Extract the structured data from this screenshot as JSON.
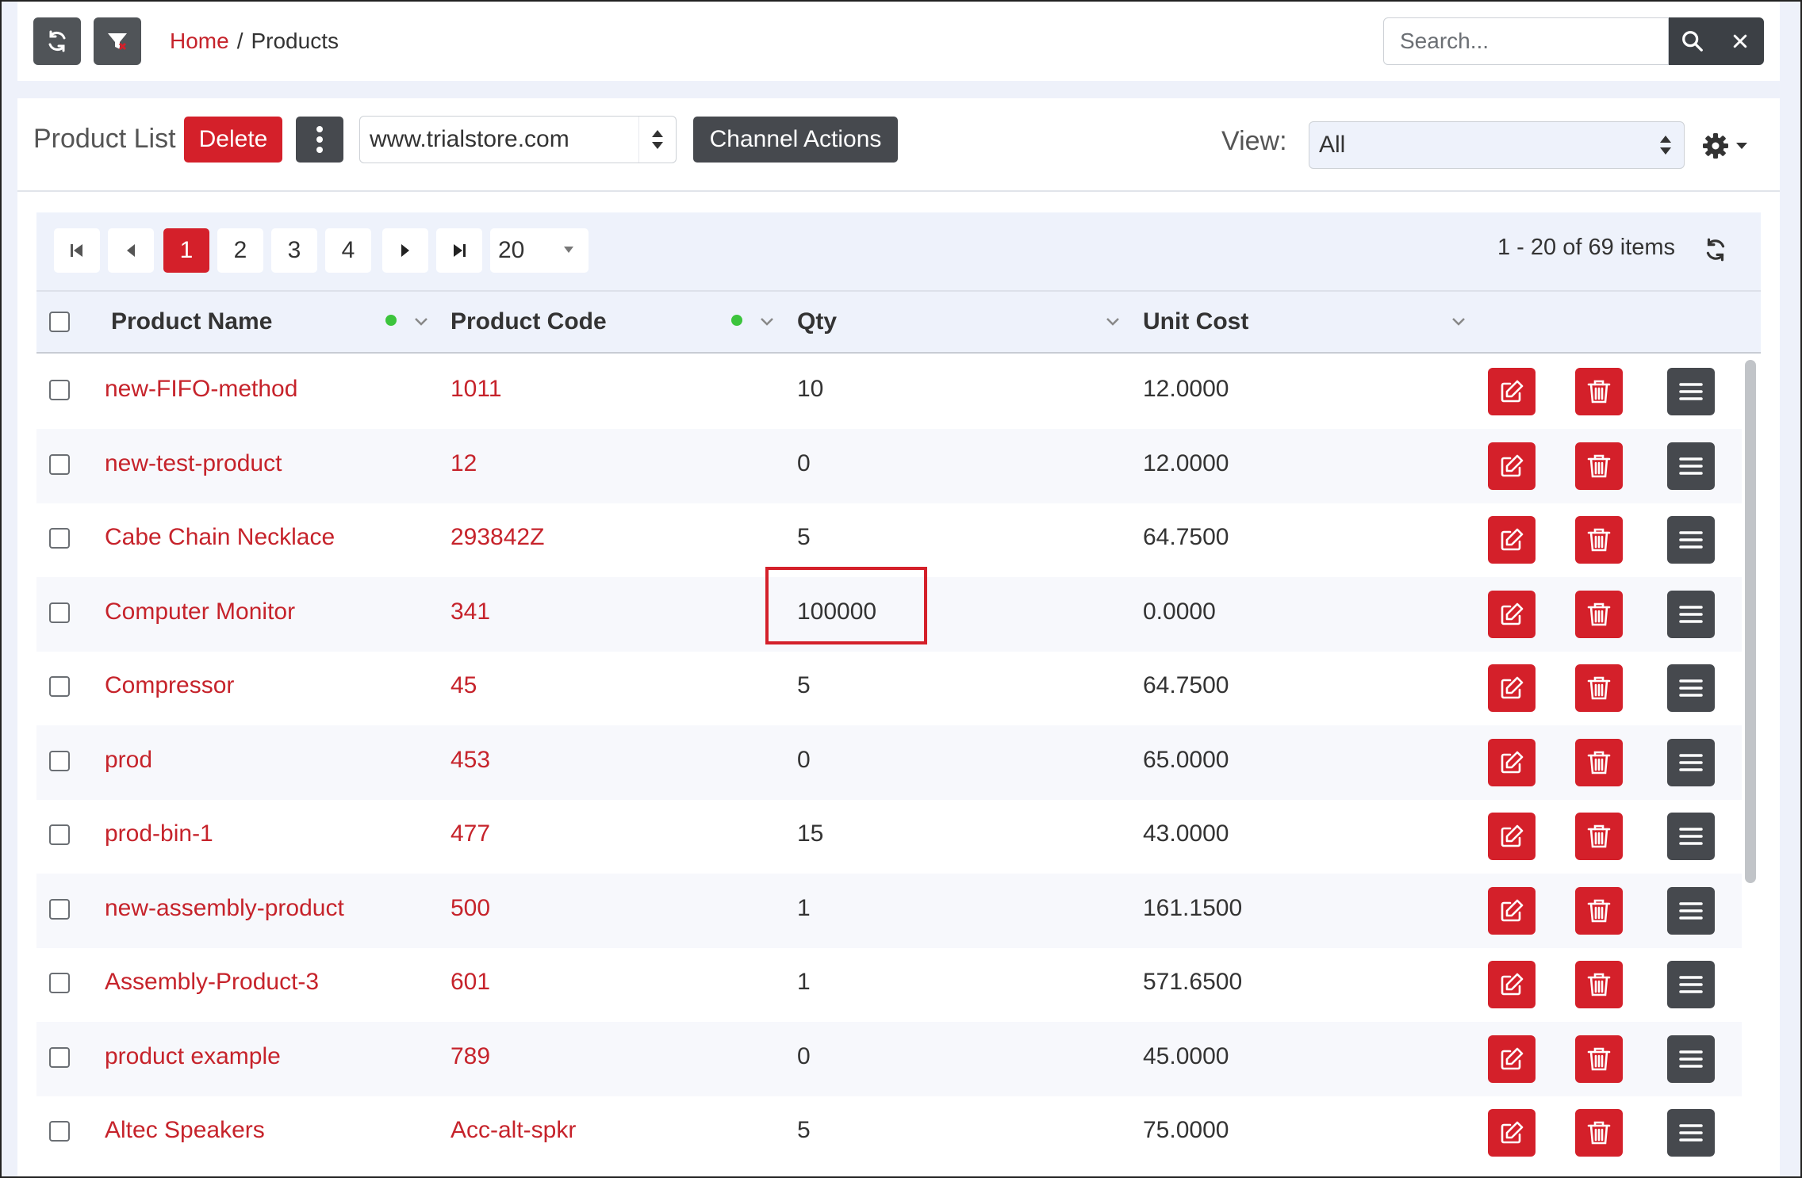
{
  "breadcrumb": {
    "home": "Home",
    "separator": "/",
    "current": "Products"
  },
  "search": {
    "placeholder": "Search..."
  },
  "toolbar": {
    "title": "Product List",
    "delete_label": "Delete",
    "channel_value": "www.trialstore.com",
    "channel_actions_label": "Channel Actions",
    "view_label": "View:",
    "view_value": "All"
  },
  "pager": {
    "pages": [
      "1",
      "2",
      "3",
      "4"
    ],
    "active_page": "1",
    "page_size": "20",
    "info": "1 - 20 of 69 items"
  },
  "columns": {
    "name": "Product Name",
    "code": "Product Code",
    "qty": "Qty",
    "cost": "Unit Cost"
  },
  "rows": [
    {
      "name": "new-FIFO-method",
      "code": "1011",
      "qty": "10",
      "cost": "12.0000"
    },
    {
      "name": "new-test-product",
      "code": "12",
      "qty": "0",
      "cost": "12.0000"
    },
    {
      "name": "Cabe Chain Necklace",
      "code": "293842Z",
      "qty": "5",
      "cost": "64.7500"
    },
    {
      "name": "Computer Monitor",
      "code": "341",
      "qty": "100000",
      "cost": "0.0000"
    },
    {
      "name": "Compressor",
      "code": "45",
      "qty": "5",
      "cost": "64.7500"
    },
    {
      "name": "prod",
      "code": "453",
      "qty": "0",
      "cost": "65.0000"
    },
    {
      "name": "prod-bin-1",
      "code": "477",
      "qty": "15",
      "cost": "43.0000"
    },
    {
      "name": "new-assembly-product",
      "code": "500",
      "qty": "1",
      "cost": "161.1500"
    },
    {
      "name": "Assembly-Product-3",
      "code": "601",
      "qty": "1",
      "cost": "571.6500"
    },
    {
      "name": "product example",
      "code": "789",
      "qty": "0",
      "cost": "45.0000"
    },
    {
      "name": "Altec Speakers",
      "code": "Acc-alt-spkr",
      "qty": "5",
      "cost": "75.0000"
    }
  ],
  "colors": {
    "accent": "#d4202a",
    "dark": "#46494e",
    "link": "#c6232b"
  }
}
